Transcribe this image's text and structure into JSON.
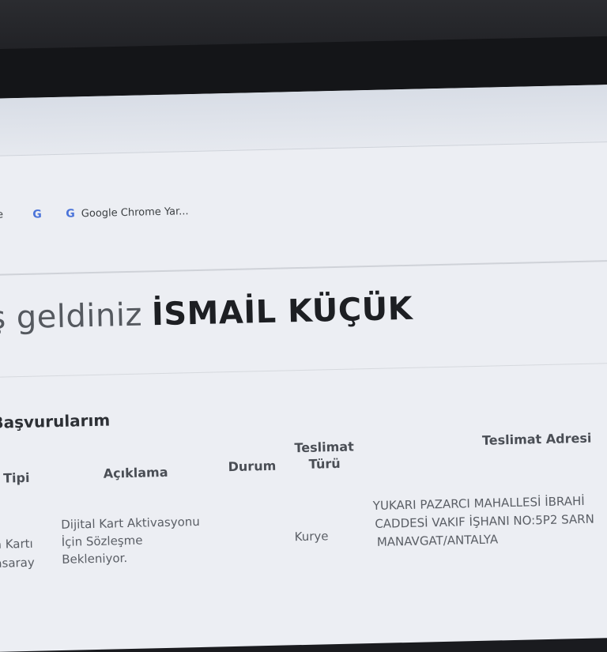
{
  "bookmarks": [
    {
      "label": "me"
    },
    {
      "label": "",
      "icon": "google-icon"
    },
    {
      "label": "Google Chrome Yar...",
      "icon": "google-icon"
    }
  ],
  "welcome": {
    "prefix": "ş geldiniz",
    "name": "İSMAİL KÜÇÜK"
  },
  "section_title": "Başvurularım",
  "table": {
    "headers": {
      "type": "t Tipi",
      "desc": "Açıklama",
      "status": "Durum",
      "delivery_type": "Teslimat Türü",
      "address": "Teslimat Adresi"
    },
    "row": {
      "type_line1": "a Kartı",
      "type_line2": "asaray",
      "desc": "Dijital Kart Aktivasyonu İçin Sözleşme Bekleniyor.",
      "status": "",
      "delivery_type": "Kurye",
      "address_line1": "YUKARI PAZARCI MAHALLESİ İBRAHİ",
      "address_line2": "CADDESİ VAKIF İŞHANI NO:5P2 SARN",
      "address_line3": "MANAVGAT/ANTALYA"
    }
  }
}
